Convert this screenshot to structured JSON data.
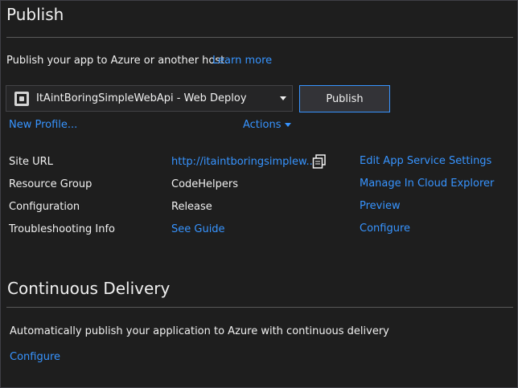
{
  "header": {
    "title": "Publish",
    "description": "Publish your app to Azure or another host.",
    "learn_more": "Learn more"
  },
  "profile": {
    "selected": "ItAintBoringSimpleWebApi - Web Deploy",
    "publish_label": "Publish",
    "new_profile": "New Profile...",
    "actions": "Actions"
  },
  "summary": {
    "rows": [
      {
        "label": "Site URL",
        "value": "http://itaintboringsimplew..."
      },
      {
        "label": "Resource Group",
        "value": "CodeHelpers"
      },
      {
        "label": "Configuration",
        "value": "Release"
      },
      {
        "label": "Troubleshooting Info",
        "value": "See Guide"
      }
    ],
    "actions": [
      "Edit App Service Settings",
      "Manage In Cloud Explorer",
      "Preview",
      "Configure"
    ]
  },
  "delivery": {
    "title": "Continuous Delivery",
    "description": "Automatically publish your application to Azure with continuous delivery",
    "configure": "Configure"
  },
  "colors": {
    "background": "#1e1e1e",
    "link": "#3794ff",
    "text": "#f1f1f1",
    "accent_border": "#3794ff"
  },
  "icons": {
    "profile": "web-deploy-icon",
    "copy": "copy-icon",
    "dropdown": "chevron-down-icon"
  }
}
